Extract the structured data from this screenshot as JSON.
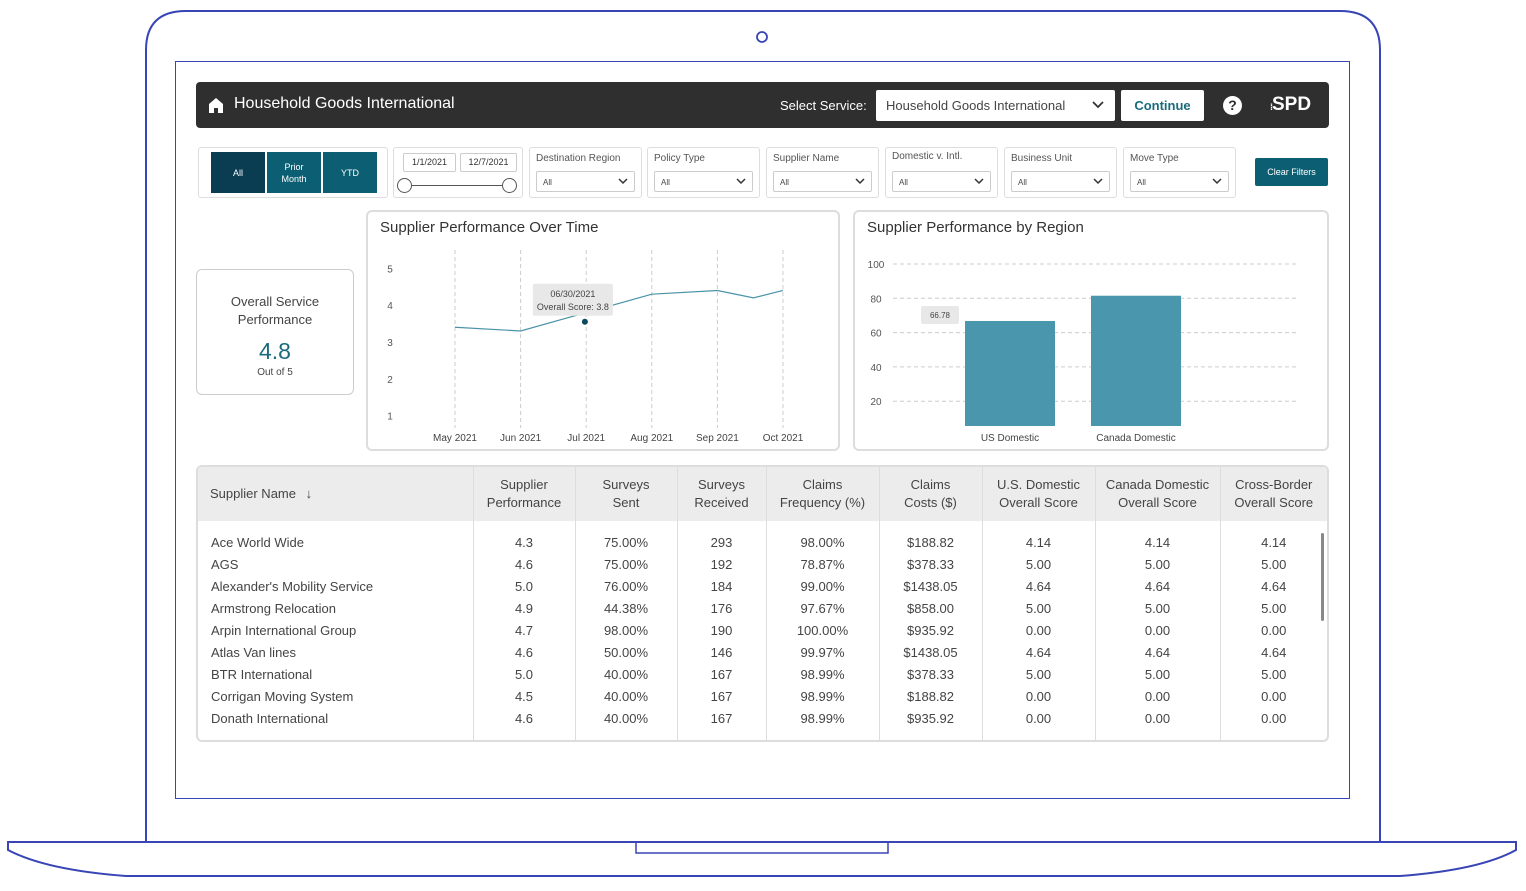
{
  "header": {
    "title": "Household Goods International",
    "select_label": "Select Service:",
    "select_value": "Household Goods International",
    "continue_label": "Continue",
    "help_label": "?",
    "logo_text": "SPD"
  },
  "period_buttons": [
    {
      "label": "All",
      "color": "#0a3d52"
    },
    {
      "label": "Prior Month",
      "color": "#0c5f73"
    },
    {
      "label": "YTD",
      "color": "#0c5f73"
    }
  ],
  "date_range": {
    "start": "1/1/2021",
    "end": "12/7/2021"
  },
  "filters": [
    {
      "label": "Destination Region",
      "value": "All"
    },
    {
      "label": "Policy Type",
      "value": "All"
    },
    {
      "label": "Supplier Name",
      "value": "All"
    },
    {
      "label": "Domestic v. Intl.",
      "value": "All"
    },
    {
      "label": "Business Unit",
      "value": "All"
    },
    {
      "label": "Move Type",
      "value": "All"
    }
  ],
  "clear_filters_label": "Clear Filters",
  "kpi": {
    "title": "Overall Service Performance",
    "value": "4.8",
    "subtitle": "Out of 5"
  },
  "chart_data": [
    {
      "type": "line",
      "title": "Supplier Performance Over Time",
      "categories": [
        "May 2021",
        "Jun 2021",
        "Jul 2021",
        "Aug 2021",
        "Sep 2021",
        "Oct 2021"
      ],
      "x": [
        "May 2021",
        "Jun 2021",
        "Jul 2021",
        "Aug 2021",
        "Sep 2021",
        "Oct 2021",
        "Oct 2021"
      ],
      "series": [
        {
          "values": [
            3.4,
            3.3,
            3.6,
            3.8,
            4.3,
            4.4,
            4.2,
            4.4
          ]
        }
      ],
      "points": [
        3.4,
        3.3,
        3.8,
        4.3,
        4.4,
        4.2,
        4.4
      ],
      "yticks": [
        1,
        2,
        3,
        4,
        5
      ],
      "ylim": [
        0.5,
        5.5
      ],
      "tooltip": {
        "date": "06/30/2021",
        "text": "Overall Score: 3.8"
      },
      "color": "#4a93a8"
    },
    {
      "type": "bar",
      "title": "Supplier Performance by Region",
      "categories": [
        "US Domestic",
        "Canada Domestic"
      ],
      "values": [
        66.78,
        81.5
      ],
      "yticks": [
        20,
        40,
        60,
        80,
        100
      ],
      "ylim": [
        10,
        100
      ],
      "data_label": "66.78",
      "color": "#4a96ad"
    }
  ],
  "table": {
    "columns": [
      "Supplier Name",
      "Supplier Performance",
      "Surveys Sent",
      "Surveys Received",
      "Claims Frequency (%)",
      "Claims Costs ($)",
      "U.S. Domestic Overall Score",
      "Canada Domestic Overall Score",
      "Cross-Border Overall Score"
    ],
    "rows": [
      [
        "Ace World Wide",
        "4.3",
        "75.00%",
        "293",
        "98.00%",
        "$188.82",
        "4.14",
        "4.14",
        "4.14"
      ],
      [
        "AGS",
        "4.6",
        "75.00%",
        "192",
        "78.87%",
        "$378.33",
        "5.00",
        "5.00",
        "5.00"
      ],
      [
        "Alexander's Mobility Service",
        "5.0",
        "76.00%",
        "184",
        "99.00%",
        "$1438.05",
        "4.64",
        "4.64",
        "4.64"
      ],
      [
        "Armstrong Relocation",
        "4.9",
        "44.38%",
        "176",
        "97.67%",
        "$858.00",
        "5.00",
        "5.00",
        "5.00"
      ],
      [
        "Arpin International Group",
        "4.7",
        "98.00%",
        "190",
        "100.00%",
        "$935.92",
        "0.00",
        "0.00",
        "0.00"
      ],
      [
        "Atlas Van lines",
        "4.6",
        "50.00%",
        "146",
        "99.97%",
        "$1438.05",
        "4.64",
        "4.64",
        "4.64"
      ],
      [
        "BTR International",
        "5.0",
        "40.00%",
        "167",
        "98.99%",
        "$378.33",
        "5.00",
        "5.00",
        "5.00"
      ],
      [
        "Corrigan Moving System",
        "4.5",
        "40.00%",
        "167",
        "98.99%",
        "$188.82",
        "0.00",
        "0.00",
        "0.00"
      ],
      [
        "Donath International",
        "4.6",
        "40.00%",
        "167",
        "98.99%",
        "$935.92",
        "0.00",
        "0.00",
        "0.00"
      ]
    ]
  }
}
